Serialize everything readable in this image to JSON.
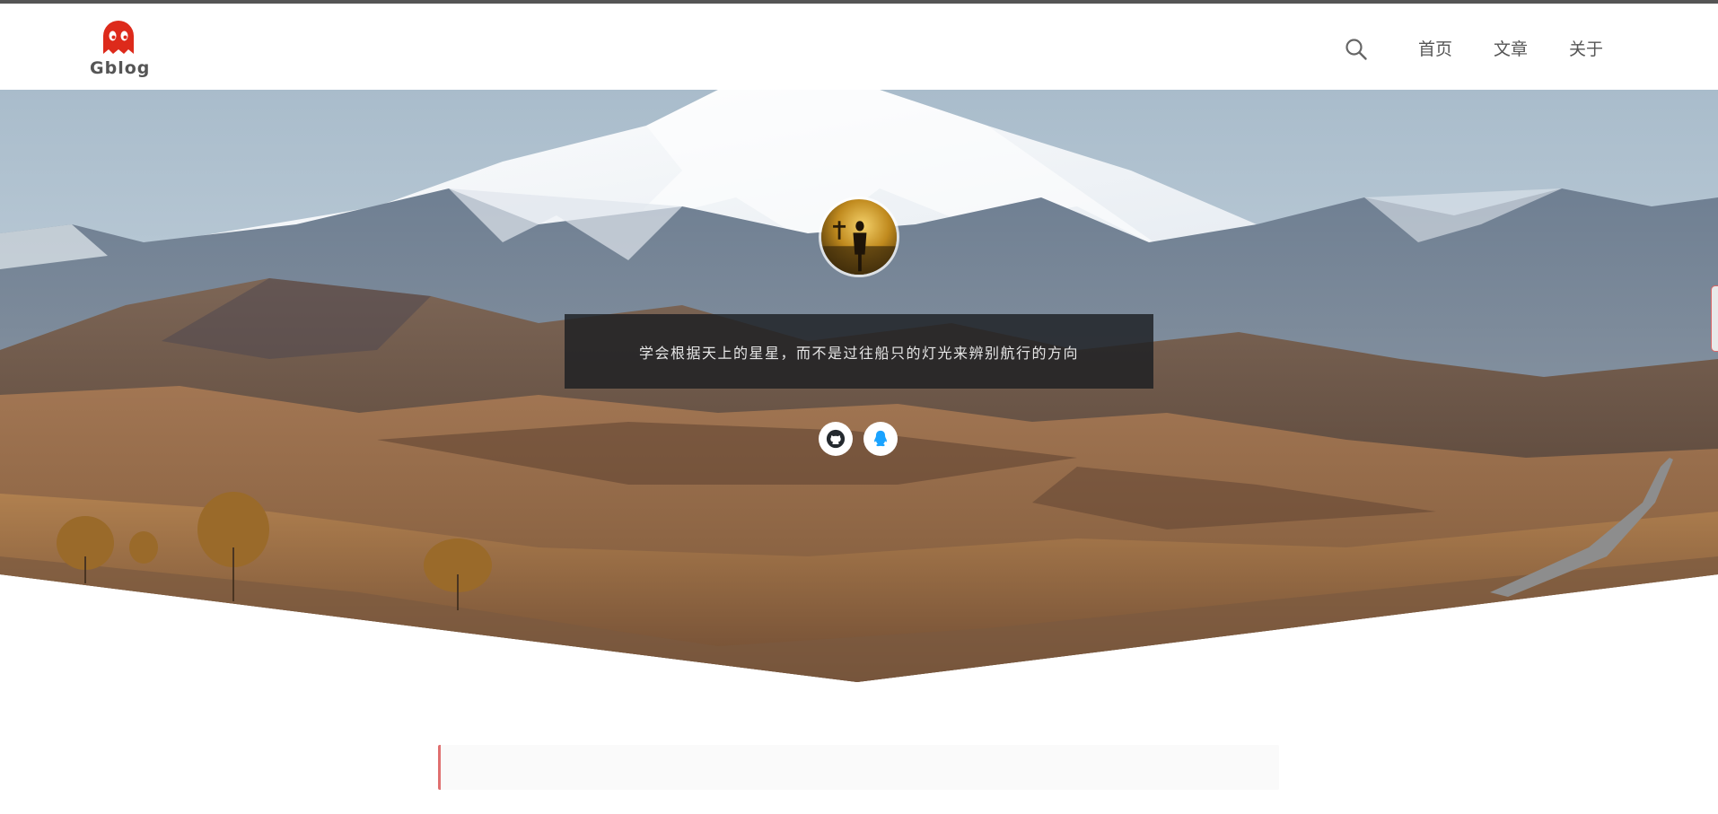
{
  "site": {
    "logo_text": "Gblog",
    "logo_icon": "ghost-icon",
    "accent_color": "#dd2a1b"
  },
  "nav": {
    "search_icon": "search-icon",
    "items": [
      {
        "label": "首页"
      },
      {
        "label": "文章"
      },
      {
        "label": "关于"
      }
    ]
  },
  "hero": {
    "background": "snow-mountain-landscape",
    "motto": "学会根据天上的星星，而不是过往船只的灯光来辨别航行的方向",
    "social": [
      {
        "icon": "github-icon",
        "color": "#24292e"
      },
      {
        "icon": "qq-icon",
        "color": "#1aa3ff"
      }
    ]
  }
}
